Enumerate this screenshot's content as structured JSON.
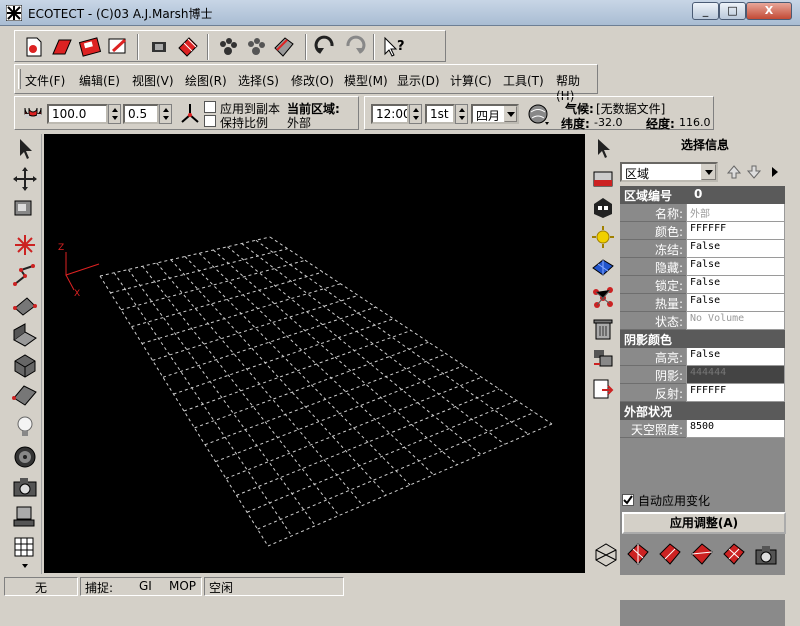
{
  "window": {
    "title": "ECOTECT - (C)03 A.J.Marsh博士",
    "min_label": "_",
    "max_label": "□",
    "close_label": "X"
  },
  "toolbar_icons": [
    "new-icon",
    "open-icon",
    "save-icon",
    "export-icon",
    "render-icon",
    "grid-icon",
    "paw-icon",
    "paw2-icon",
    "book-icon",
    "undo-icon",
    "redo-icon",
    "help-icon"
  ],
  "menu": [
    {
      "label": "文件(F)"
    },
    {
      "label": "编辑(E)"
    },
    {
      "label": "视图(V)"
    },
    {
      "label": "绘图(R)"
    },
    {
      "label": "选择(S)"
    },
    {
      "label": "修改(O)"
    },
    {
      "label": "模型(M)"
    },
    {
      "label": "显示(D)"
    },
    {
      "label": "计算(C)"
    },
    {
      "label": "工具(T)"
    },
    {
      "label": "帮助(H)"
    }
  ],
  "toolbar3": {
    "value1": "100.0",
    "value2": "0.5",
    "apply_label": "应用到副本",
    "keep_ratio_label": "保持比例",
    "zone_label": "当前区域:",
    "zone_value": "外部"
  },
  "toolbar4": {
    "time": "12:00",
    "day": "1st",
    "month": "四月",
    "weather_label": "气候:",
    "weather_value": "[无数据文件]",
    "lat_label": "纬度:",
    "lat_value": "-32.0",
    "lon_label": "经度:",
    "lon_value": "116.0"
  },
  "panel": {
    "title": "选择信息",
    "select_value": "区域",
    "section1_header": "区域编号",
    "section1_value": "0",
    "rows1": [
      {
        "key": "名称:",
        "value": "外部"
      },
      {
        "key": "颜色:",
        "value": "FFFFFF"
      },
      {
        "key": "冻结:",
        "value": "False"
      },
      {
        "key": "隐藏:",
        "value": "False"
      },
      {
        "key": "锁定:",
        "value": "False"
      },
      {
        "key": "热量:",
        "value": "False"
      },
      {
        "key": "状态:",
        "value": "No Volume"
      }
    ],
    "section2_header": "阴影颜色",
    "rows2": [
      {
        "key": "高亮:",
        "value": "False"
      },
      {
        "key": "阴影:",
        "value": "444444"
      },
      {
        "key": "反射:",
        "value": "FFFFFF"
      }
    ],
    "section3_header": "外部状况",
    "rows3": [
      {
        "key": "天空照度:",
        "value": "8500"
      }
    ],
    "auto_apply_label": "自动应用变化",
    "apply_button": "应用调整(A)"
  },
  "status": {
    "cell1": "无",
    "snap_label": "捕捉:",
    "snap_gi": "GI",
    "snap_mop": "MOP",
    "cell4": "空闲"
  },
  "viewport": {
    "axis_z": "Z",
    "axis_x": "X"
  }
}
